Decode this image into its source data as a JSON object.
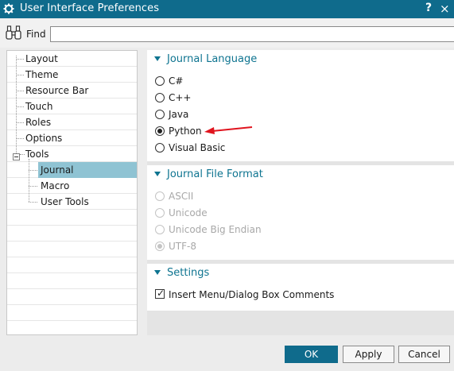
{
  "window": {
    "title": "User Interface Preferences",
    "help_label": "?",
    "close_label": "×"
  },
  "find": {
    "label": "Find",
    "value": ""
  },
  "tree": {
    "items": [
      {
        "label": "Layout"
      },
      {
        "label": "Theme"
      },
      {
        "label": "Resource Bar"
      },
      {
        "label": "Touch"
      },
      {
        "label": "Roles"
      },
      {
        "label": "Options"
      },
      {
        "label": "Tools"
      },
      {
        "label": "Journal",
        "selected": true
      },
      {
        "label": "Macro"
      },
      {
        "label": "User Tools"
      }
    ],
    "selected_color": "#8fc3d3"
  },
  "sections": {
    "language": {
      "title": "Journal Language",
      "options": [
        "C#",
        "C++",
        "Java",
        "Python",
        "Visual Basic"
      ],
      "selected": "Python"
    },
    "format": {
      "title": "Journal File Format",
      "options": [
        "ASCII",
        "Unicode",
        "Unicode Big Endian",
        "UTF-8"
      ],
      "selected": "UTF-8",
      "disabled": true
    },
    "settings": {
      "title": "Settings",
      "checkbox_label": "Insert Menu/Dialog Box Comments",
      "checked": true
    }
  },
  "annotation": {
    "arrow_color": "#e0141e"
  },
  "buttons": {
    "ok": "OK",
    "apply": "Apply",
    "cancel": "Cancel"
  },
  "colors": {
    "titlebar": "#0f6b8c",
    "accent": "#0e7490"
  }
}
